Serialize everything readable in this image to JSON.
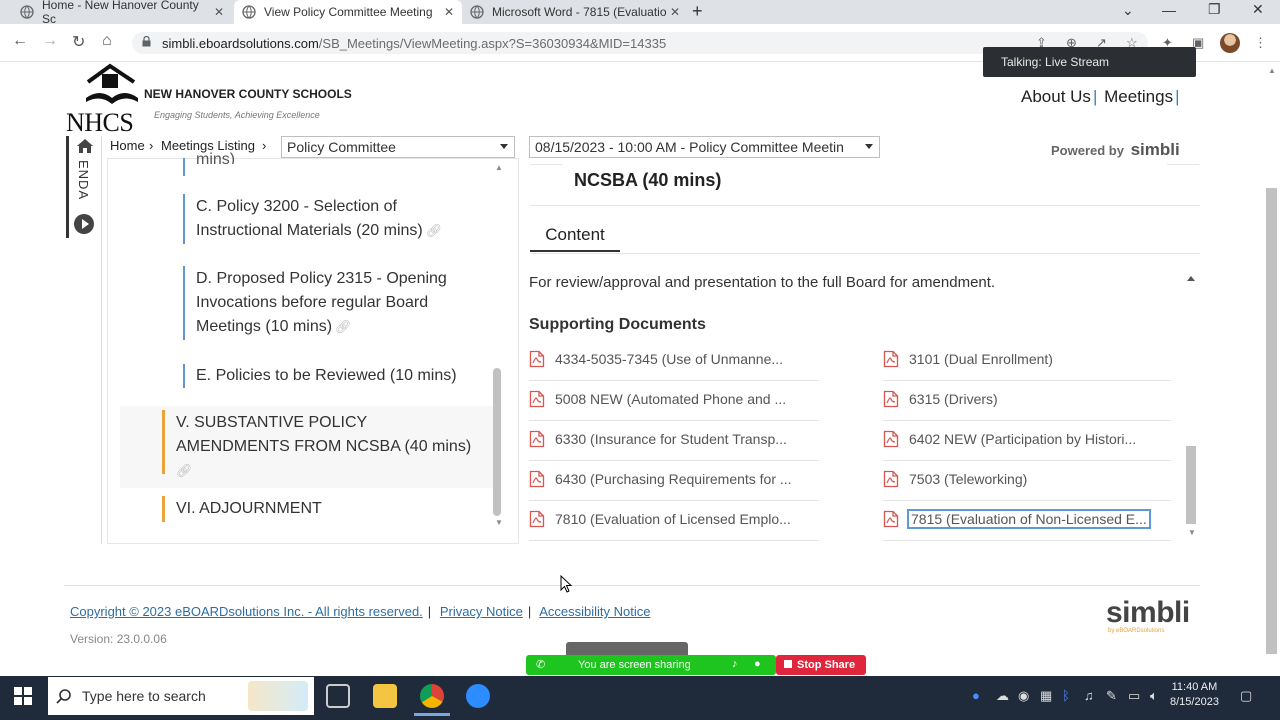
{
  "browser": {
    "tabs": [
      {
        "label": "Home - New Hanover County Sc",
        "active": false
      },
      {
        "label": "View Policy Committee Meeting",
        "active": true
      },
      {
        "label": "Microsoft Word - 7815 (Evaluatio",
        "active": false
      }
    ],
    "url_host": "simbli.eboardsolutions.com",
    "url_path": "/SB_Meetings/ViewMeeting.aspx?S=36030934&MID=14335"
  },
  "header": {
    "logo_text": "NHCS",
    "org_name": "NEW HANOVER COUNTY SCHOOLS",
    "tagline": "Engaging Students, Achieving Excellence",
    "nav": [
      "About Us",
      "Meetings"
    ],
    "popup": "Talking: Live Stream"
  },
  "breadcrumb": {
    "home": "Home",
    "listing": "Meetings Listing",
    "committee_select": "Policy Committee",
    "meeting_select": "08/15/2023 - 10:00 AM - Policy Committee Meetin",
    "powered_by": "Powered by",
    "powered_brand": "simbli"
  },
  "agenda": {
    "side_label": "ENDA",
    "partial_top": "mins)",
    "items": [
      {
        "line1": "C. Policy 3200 - Selection of",
        "line2": "Instructional Materials (20 mins)"
      },
      {
        "line1": "D. Proposed Policy 2315 - Opening",
        "line2": "Invocations before regular Board",
        "line3": "Meetings (10 mins)"
      },
      {
        "line1": "E. Policies to be Reviewed (10 mins)"
      },
      {
        "line1": "V. SUBSTANTIVE POLICY",
        "line2": "AMENDMENTS FROM NCSBA (40 mins)"
      },
      {
        "line1": "VI. ADJOURNMENT"
      }
    ]
  },
  "detail": {
    "title": "NCSBA (40 mins)",
    "tab": "Content",
    "description": "For review/approval and presentation to the full Board for amendment.",
    "supporting_heading": "Supporting Documents",
    "docs_left": [
      "4334-5035-7345 (Use of Unmanne...",
      "5008 NEW (Automated Phone and ...",
      "6330 (Insurance for Student Transp...",
      "6430 (Purchasing Requirements for ...",
      "7810 (Evaluation of Licensed Emplo..."
    ],
    "docs_right": [
      "3101 (Dual Enrollment)",
      "6315 (Drivers)",
      "6402 NEW (Participation by Histori...",
      "7503 (Teleworking)",
      "7815 (Evaluation of Non-Licensed E..."
    ]
  },
  "footer": {
    "copyright": "Copyright © 2023 eBOARDsolutions Inc. - All rights reserved.",
    "privacy": "Privacy Notice",
    "accessibility": "Accessibility Notice",
    "version": "Version: 23.0.0.06",
    "brand": "simbli",
    "brand_sub": "by eBOARDsolutions"
  },
  "zoom": {
    "sharing": "You are screen sharing",
    "stop": "Stop Share"
  },
  "taskbar": {
    "search_placeholder": "Type here to search",
    "time": "11:40 AM",
    "date": "8/15/2023"
  },
  "colors": {
    "accent_blue": "#5b9bd5",
    "accent_orange": "#e8a33c",
    "pdf_red": "#d9534f",
    "link": "#2e6da4"
  }
}
